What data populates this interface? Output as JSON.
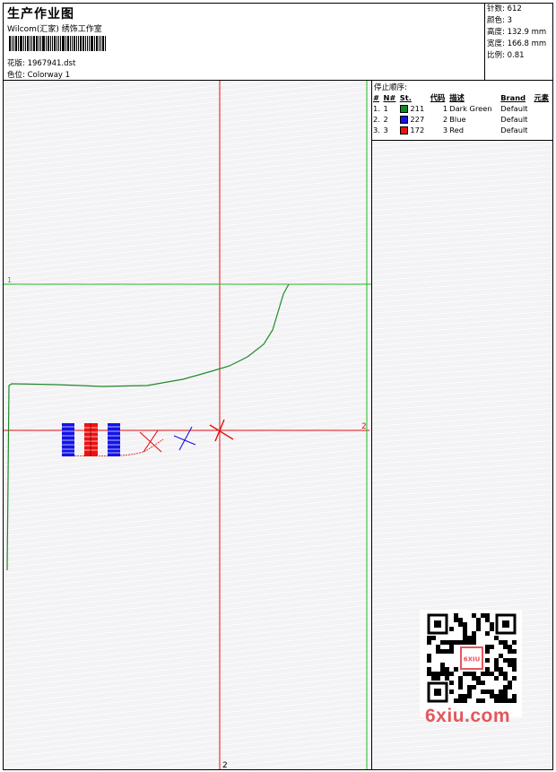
{
  "header": {
    "title": "生产作业图",
    "subtitle": "Wilcom(汇家) 绣饰工作室",
    "design_label": "花版:",
    "design_value": "1967941.dst",
    "colorway_label": "色位:",
    "colorway_value": "Colorway 1"
  },
  "stats": {
    "stitches_label": "针数:",
    "stitches_value": "612",
    "colors_label": "颜色:",
    "colors_value": "3",
    "height_label": "高度:",
    "height_value": "132.9 mm",
    "width_label": "宽度:",
    "width_value": "166.8 mm",
    "scale_label": "比例:",
    "scale_value": "0.81"
  },
  "stop_sequence": {
    "title": "停止顺序:",
    "columns": [
      "#",
      "N#",
      "St.",
      "代码",
      "描述",
      "Brand",
      "元素"
    ],
    "rows": [
      {
        "idx": "1.",
        "n": "1",
        "color": "#0b8a1e",
        "st": "211",
        "code": "1",
        "desc": "Dark Green",
        "brand": "Default"
      },
      {
        "idx": "2.",
        "n": "2",
        "color": "#1414e6",
        "st": "227",
        "code": "2",
        "desc": "Blue",
        "brand": "Default"
      },
      {
        "idx": "3.",
        "n": "3",
        "color": "#ee1111",
        "st": "172",
        "code": "3",
        "desc": "Red",
        "brand": "Default"
      }
    ]
  },
  "guides": {
    "label_1": "1",
    "label_2_right": "2",
    "label_2_bottom": "2",
    "green": "#22bb22",
    "red": "#e01010"
  },
  "watermark": {
    "qr_badge": "6XIU",
    "text": "6xiu.com",
    "color": "#e3575c"
  }
}
